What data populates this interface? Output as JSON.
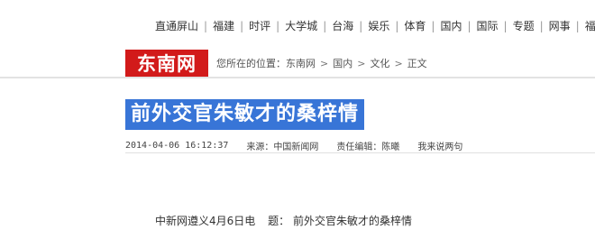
{
  "topnav": {
    "items": [
      "直通屏山",
      "福建",
      "时评",
      "大学城",
      "台海",
      "娱乐",
      "体育",
      "国内",
      "国际",
      "专题",
      "网事",
      "福州"
    ],
    "separator": "|"
  },
  "logo": {
    "text": "东南网",
    "color": "#d21a1a"
  },
  "breadcrumb": {
    "prefix": "您所在的位置：",
    "items": [
      "东南网",
      "国内",
      "文化",
      "正文"
    ],
    "separator": ">"
  },
  "article": {
    "title": "前外交官朱敏才的桑梓情",
    "title_highlight_color": "#3875d7",
    "meta": {
      "date": "2014-04-06 16:12:37",
      "source_label": "来源：",
      "source_value": "中国新闻网",
      "editor_label": "责任编辑：",
      "editor_value": "陈曦",
      "comment_link": "我来说两句"
    },
    "lead": {
      "dateline": "中新网遵义4月6日电",
      "title_label": "题：",
      "title_text": "前外交官朱敏才的桑梓情"
    }
  }
}
